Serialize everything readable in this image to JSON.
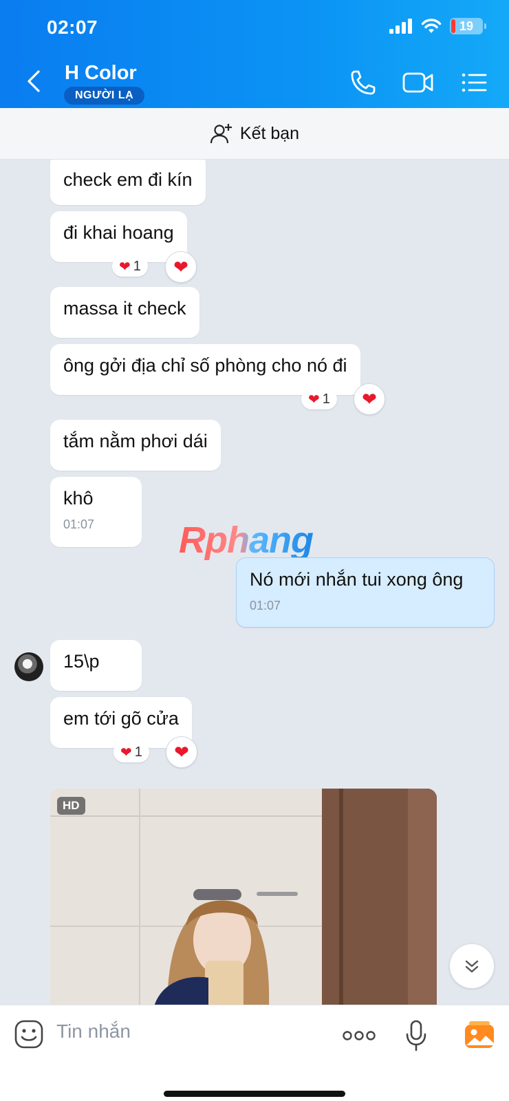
{
  "status_bar": {
    "time": "02:07",
    "battery": "19"
  },
  "header": {
    "contact_name": "H Color",
    "badge": "NGƯỜI LẠ",
    "icons": [
      "back-icon",
      "phone-icon",
      "video-call-icon",
      "menu-list-icon"
    ]
  },
  "add_friend": {
    "label": "Kết bạn",
    "icon": "add-user-icon"
  },
  "watermark": "Rphang",
  "messages": [
    {
      "text": "check em đi kín"
    },
    {
      "text": "đi khai hoang",
      "reaction_count": "1"
    },
    {
      "text": "massa it check"
    },
    {
      "text": "ông gởi địa chỉ số phòng cho nó đi",
      "reaction_count": "1"
    },
    {
      "text": "tắm nằm phơi dái"
    },
    {
      "text": "khô",
      "time": "01:07"
    },
    {
      "text": "Nó mới nhắn tui xong ông",
      "time": "01:07",
      "sender": "me"
    },
    {
      "text": "15\\p"
    },
    {
      "text": "em tới gõ cửa",
      "reaction_count": "1"
    }
  ],
  "photo": {
    "badge": "HD"
  },
  "composer": {
    "placeholder": "Tin nhắn"
  },
  "colors": {
    "header": "#0b8cf2",
    "my_bubble": "#d6ecff",
    "badge": "#0a5fc2",
    "heart": "#e8192c"
  }
}
